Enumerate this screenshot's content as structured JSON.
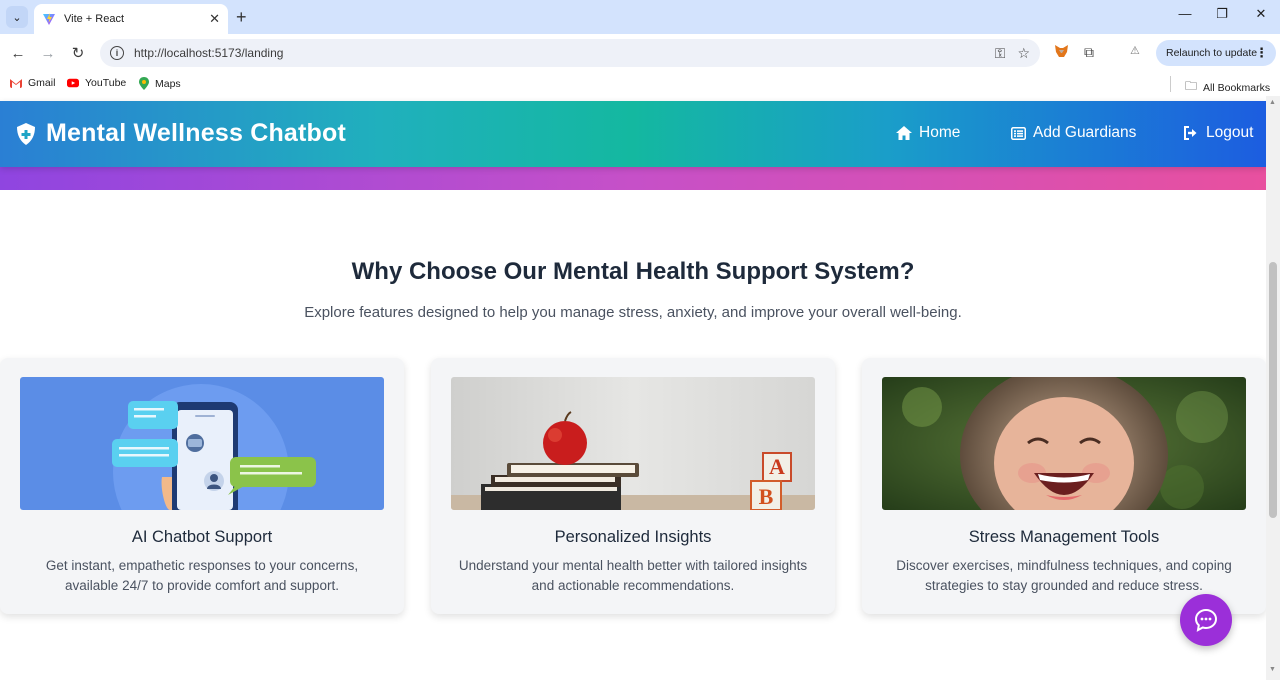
{
  "browser": {
    "tab_title": "Vite + React",
    "url": "http://localhost:5173/landing",
    "relaunch_label": "Relaunch to update",
    "bookmarks": [
      {
        "label": "Gmail"
      },
      {
        "label": "YouTube"
      },
      {
        "label": "Maps"
      }
    ],
    "all_bookmarks_label": "All Bookmarks"
  },
  "navbar": {
    "brand": "Mental Wellness Chatbot",
    "links": [
      {
        "label": "Home",
        "icon": "home-icon"
      },
      {
        "label": "Add Guardians",
        "icon": "list-icon"
      },
      {
        "label": "Logout",
        "icon": "logout-icon"
      }
    ]
  },
  "section": {
    "heading": "Why Choose Our Mental Health Support System?",
    "subheading": "Explore features designed to help you manage stress, anxiety, and improve your overall well-being."
  },
  "cards": [
    {
      "title": "AI Chatbot Support",
      "description": "Get instant, empathetic responses to your concerns, available 24/7 to provide comfort and support.",
      "image": "chatbot-illustration"
    },
    {
      "title": "Personalized Insights",
      "description": "Understand your mental health better with tailored insights and actionable recommendations.",
      "image": "apple-books-photo"
    },
    {
      "title": "Stress Management Tools",
      "description": "Discover exercises, mindfulness techniques, and coping strategies to stay grounded and reduce stress.",
      "image": "laughing-child-photo"
    }
  ],
  "colors": {
    "navbar_gradient_start": "#2a7fd4",
    "navbar_gradient_mid": "#14b8a0",
    "navbar_gradient_end": "#1c5de0",
    "strip_gradient_start": "#8f45e0",
    "strip_gradient_end": "#e8509f",
    "chat_button": "#9b2fd9",
    "heading_text": "#1e2a3b"
  }
}
